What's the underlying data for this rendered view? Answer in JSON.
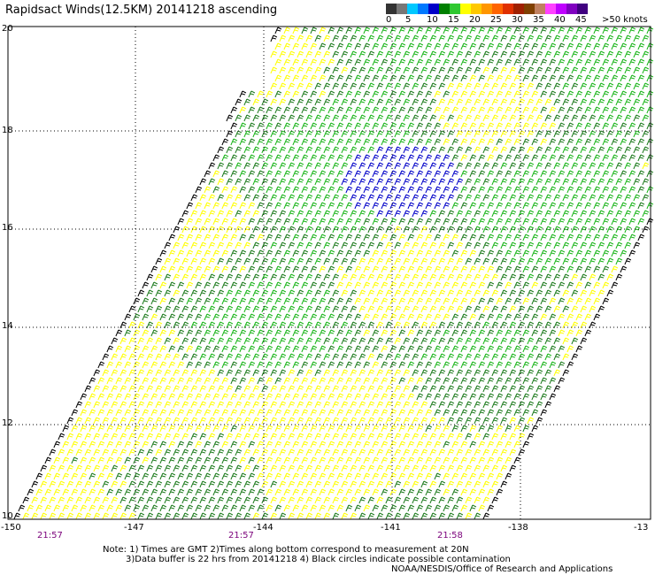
{
  "title": "Rapidsact Winds(12.5KM) 20141218 ascending",
  "legend": {
    "colors": [
      "#333333",
      "#777777",
      "#00c8ff",
      "#0078ff",
      "#0000c8",
      "#008000",
      "#30c830",
      "#ffff00",
      "#ffc800",
      "#ff9600",
      "#ff6400",
      "#e03000",
      "#a02000",
      "#804000",
      "#c08060",
      "#ff40ff",
      "#c000ff",
      "#8000c0",
      "#400080"
    ],
    "labels": [
      "0",
      "5",
      "10",
      "15",
      "20",
      "25",
      "30",
      "35",
      "40",
      "45",
      ">50 knots"
    ]
  },
  "axes": {
    "lat_labels": [
      "20",
      "18",
      "16",
      "14",
      "12",
      "10"
    ],
    "lon_labels": [
      "-150",
      "-147",
      "-144",
      "-141",
      "-138",
      "-13"
    ],
    "times": [
      "21:57",
      "21:57",
      "21:58"
    ]
  },
  "notes": {
    "line1": "Note: 1) Times are GMT 2)Times along bottom correspond to measurement at 20N",
    "line2": "3)Data buffer is 22 hrs from 20141218 4) Black circles indicate possible contamination",
    "line3": "NOAA/NESDIS/Office of Research and Applications"
  },
  "barb_colors": {
    "yellow": "#ffff00",
    "green_dark": "#1c7a1c",
    "green": "#18b418",
    "blue": "#0000c8",
    "black": "#000000"
  }
}
